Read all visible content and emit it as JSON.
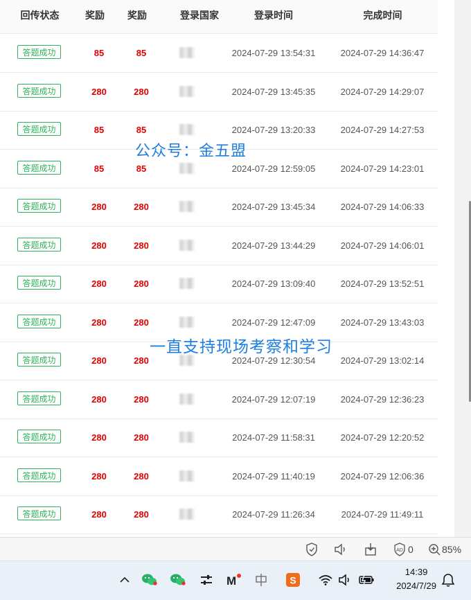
{
  "table": {
    "headers": [
      "回传状态",
      "奖励",
      "奖励",
      "登录国家",
      "登录时间",
      "完成时间"
    ],
    "rows": [
      {
        "status": "答题成功",
        "reward1": "85",
        "reward2": "85",
        "login": "2024-07-29 13:54:31",
        "done": "2024-07-29 14:36:47"
      },
      {
        "status": "答题成功",
        "reward1": "280",
        "reward2": "280",
        "login": "2024-07-29 13:45:35",
        "done": "2024-07-29 14:29:07"
      },
      {
        "status": "答题成功",
        "reward1": "85",
        "reward2": "85",
        "login": "2024-07-29 13:20:33",
        "done": "2024-07-29 14:27:53"
      },
      {
        "status": "答题成功",
        "reward1": "85",
        "reward2": "85",
        "login": "2024-07-29 12:59:05",
        "done": "2024-07-29 14:23:01"
      },
      {
        "status": "答题成功",
        "reward1": "280",
        "reward2": "280",
        "login": "2024-07-29 13:45:34",
        "done": "2024-07-29 14:06:33"
      },
      {
        "status": "答题成功",
        "reward1": "280",
        "reward2": "280",
        "login": "2024-07-29 13:44:29",
        "done": "2024-07-29 14:06:01"
      },
      {
        "status": "答题成功",
        "reward1": "280",
        "reward2": "280",
        "login": "2024-07-29 13:09:40",
        "done": "2024-07-29 13:52:51"
      },
      {
        "status": "答题成功",
        "reward1": "280",
        "reward2": "280",
        "login": "2024-07-29 12:47:09",
        "done": "2024-07-29 13:43:03"
      },
      {
        "status": "答题成功",
        "reward1": "280",
        "reward2": "280",
        "login": "2024-07-29 12:30:54",
        "done": "2024-07-29 13:02:14"
      },
      {
        "status": "答题成功",
        "reward1": "280",
        "reward2": "280",
        "login": "2024-07-29 12:07:19",
        "done": "2024-07-29 12:36:23"
      },
      {
        "status": "答题成功",
        "reward1": "280",
        "reward2": "280",
        "login": "2024-07-29 11:58:31",
        "done": "2024-07-29 12:20:52"
      },
      {
        "status": "答题成功",
        "reward1": "280",
        "reward2": "280",
        "login": "2024-07-29 11:40:19",
        "done": "2024-07-29 12:06:36"
      },
      {
        "status": "答题成功",
        "reward1": "280",
        "reward2": "280",
        "login": "2024-07-29 11:26:34",
        "done": "2024-07-29 11:49:11"
      }
    ]
  },
  "watermarks": {
    "top": "公众号：金五盟",
    "middle": "一直支持现场考察和学习"
  },
  "browser_status": {
    "adblock_count": "0",
    "zoom": "85%"
  },
  "taskbar": {
    "time": "14:39",
    "date": "2024/7/29",
    "icons": [
      "chevron-up-icon",
      "wechat-icon",
      "wechat-icon",
      "settings-sliders-icon",
      "mail-m-icon",
      "ime-zhong-icon",
      "sogou-s-icon",
      "wifi-icon",
      "volume-icon",
      "battery-icon",
      "notification-icon"
    ]
  },
  "colors": {
    "success": "#2fb35a",
    "reward": "#e00000",
    "watermark": "#1e7fe0"
  }
}
